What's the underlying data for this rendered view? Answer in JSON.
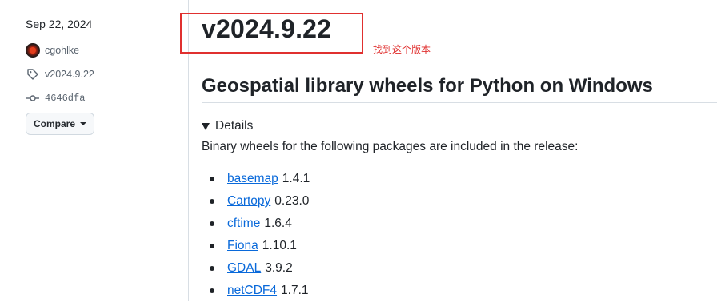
{
  "sidebar": {
    "date": "Sep 22, 2024",
    "author": "cgohlke",
    "tag": "v2024.9.22",
    "commit": "4646dfa",
    "compare_label": "Compare"
  },
  "release": {
    "title": "v2024.9.22",
    "annotation": "找到这个版本",
    "heading": "Geospatial library wheels for Python on Windows",
    "details_label": "Details",
    "intro": "Binary wheels for the following packages are included in the release:",
    "packages": [
      {
        "name": "basemap",
        "version": "1.4.1"
      },
      {
        "name": "Cartopy",
        "version": "0.23.0"
      },
      {
        "name": "cftime",
        "version": "1.6.4"
      },
      {
        "name": "Fiona",
        "version": "1.10.1"
      },
      {
        "name": "GDAL",
        "version": "3.9.2"
      },
      {
        "name": "netCDF4",
        "version": "1.7.1"
      }
    ]
  },
  "colors": {
    "link": "#0969da",
    "annotation_red": "#e0302f"
  },
  "icons": [
    "avatar",
    "tag-icon",
    "commit-icon",
    "caret-down-icon",
    "triangle-down-icon"
  ]
}
